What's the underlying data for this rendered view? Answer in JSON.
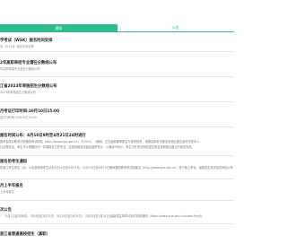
{
  "tabs": [
    {
      "label": "通知",
      "active": true
    },
    {
      "label": "公告",
      "active": false
    }
  ],
  "colors": {
    "accent": "#2cbd8e"
  },
  "items": [
    {
      "title": "学考试（WSK）报名时间安排",
      "lines": [
        "月, 2019年: 报名时间安排"
      ]
    },
    {
      "title": "2年高职单招专业潜在分数线公布",
      "lines": [
        "年高职单招专业潜在分数线公布"
      ]
    },
    {
      "title": "江省2023年单独招生分数线公布",
      "lines": [
        "2023年单独招生分数线公布"
      ]
    },
    {
      "title": "月考证打印时间:10月10日15:00",
      "lines": [
        "证打印时间:10月10日15:00"
      ]
    },
    {
      "title": "报名时间公布：4月10日9时至4月21日24时进行",
      "lines": [
        "报考各类高职考试资格的考试网站（http://www.zjzs.gov.cn）于2023、（期间，正在最新春季报名与准考报考，填报高职考试报名系统后提交及时完成本人",
        "认证等信息，考生可以根据情况一并填报自己的专业，应选择最喜欢最合适的专业，以满足时间计，考生可在考试网站提交报名表和报名截止时间前完成。"
      ]
    },
    {
      "title": "报名的考生通知",
      "lines": [
        "的浙江考生考生（请，以及其他报考生请在5月12日至5月13日，12月13日至6月13日期间登陆教育考试网报名（http://www.zjzs.edu.cn）进行网上申请，最新招生情况会在网站公布"
      ]
    },
    {
      "title": "月上半年报名",
      "lines": [
        "上半年报名"
      ]
    },
    {
      "title": "次公告",
      "lines": [
        "：（3月1日至3月8日，3月4日至3月15日，3月15日至3月31日）（3月1日至3月31日)最新招生简章请及时查看通知（https://www.zjzs.edu.cn/index.html)，"
      ]
    },
    {
      "title": "浙江省普通高校招生（高职）",
      "lines": []
    }
  ]
}
